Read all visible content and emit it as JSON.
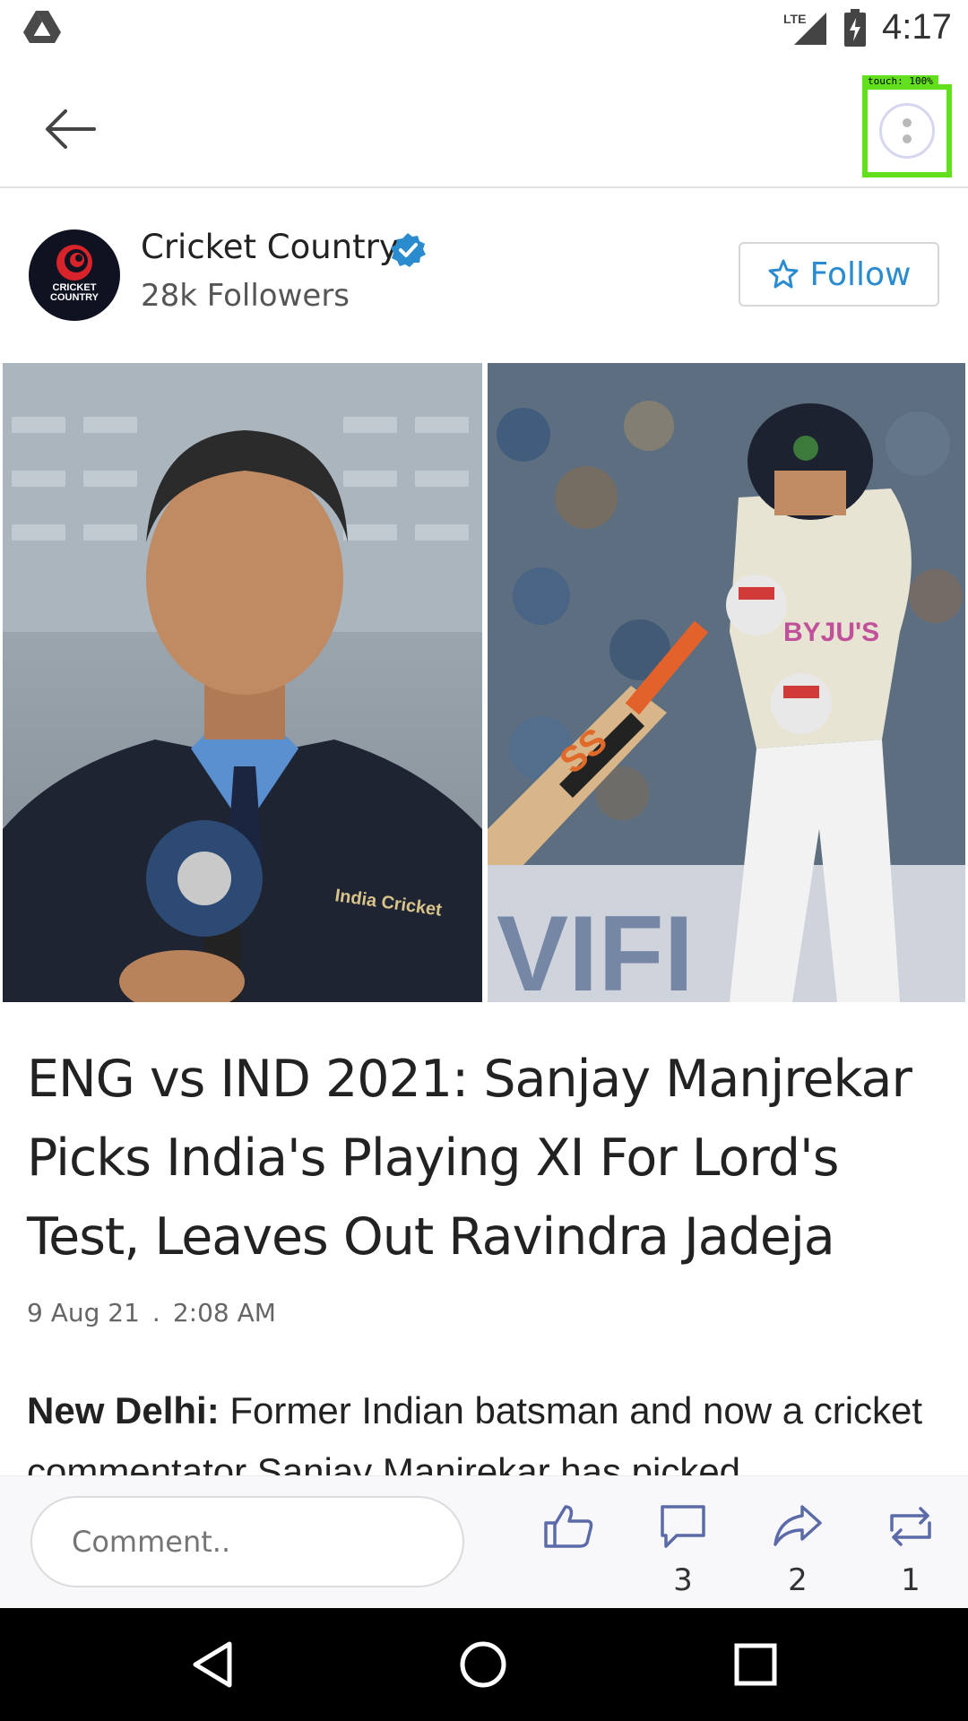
{
  "status_bar": {
    "network": "LTE",
    "time": "4:17",
    "icons": [
      "drive-icon",
      "lte-signal-icon",
      "battery-charging-icon"
    ]
  },
  "app_bar": {
    "back_icon": "arrow-left-icon",
    "more_icon": "more-vert-icon",
    "touch_label": "touch: 100%"
  },
  "publisher": {
    "name": "Cricket Country",
    "verified": true,
    "followers": "28k Followers",
    "follow_label": "Follow",
    "logo_text_1": "CRICKET",
    "logo_text_2": "COUNTRY"
  },
  "hero_image": {
    "left_caption": "India Cricket",
    "right_caption_1": "BYJU'S",
    "right_caption_2": "SS"
  },
  "article": {
    "headline": "ENG vs IND 2021: Sanjay Manjrekar Picks India's Playing XI For Lord's Test, Leaves Out Ravindra Jadeja",
    "date": "9 Aug 21",
    "separator": ".",
    "time": "2:08 AM",
    "dateline": "New Delhi:",
    "body": "Former Indian batsman and now a cricket commentator Sanjay Manjrekar has picked"
  },
  "action_bar": {
    "comment_placeholder": "Comment..",
    "actions": [
      {
        "name": "like",
        "icon": "thumbs-up-icon",
        "count": ""
      },
      {
        "name": "comment",
        "icon": "comment-icon",
        "count": "3"
      },
      {
        "name": "share",
        "icon": "share-icon",
        "count": "2"
      },
      {
        "name": "repost",
        "icon": "repost-icon",
        "count": "1"
      }
    ]
  },
  "colors": {
    "accent": "#2a8ccf",
    "verified": "#2a8ccf",
    "highlight_box": "#62e01e",
    "nav_bar": "#000000"
  }
}
